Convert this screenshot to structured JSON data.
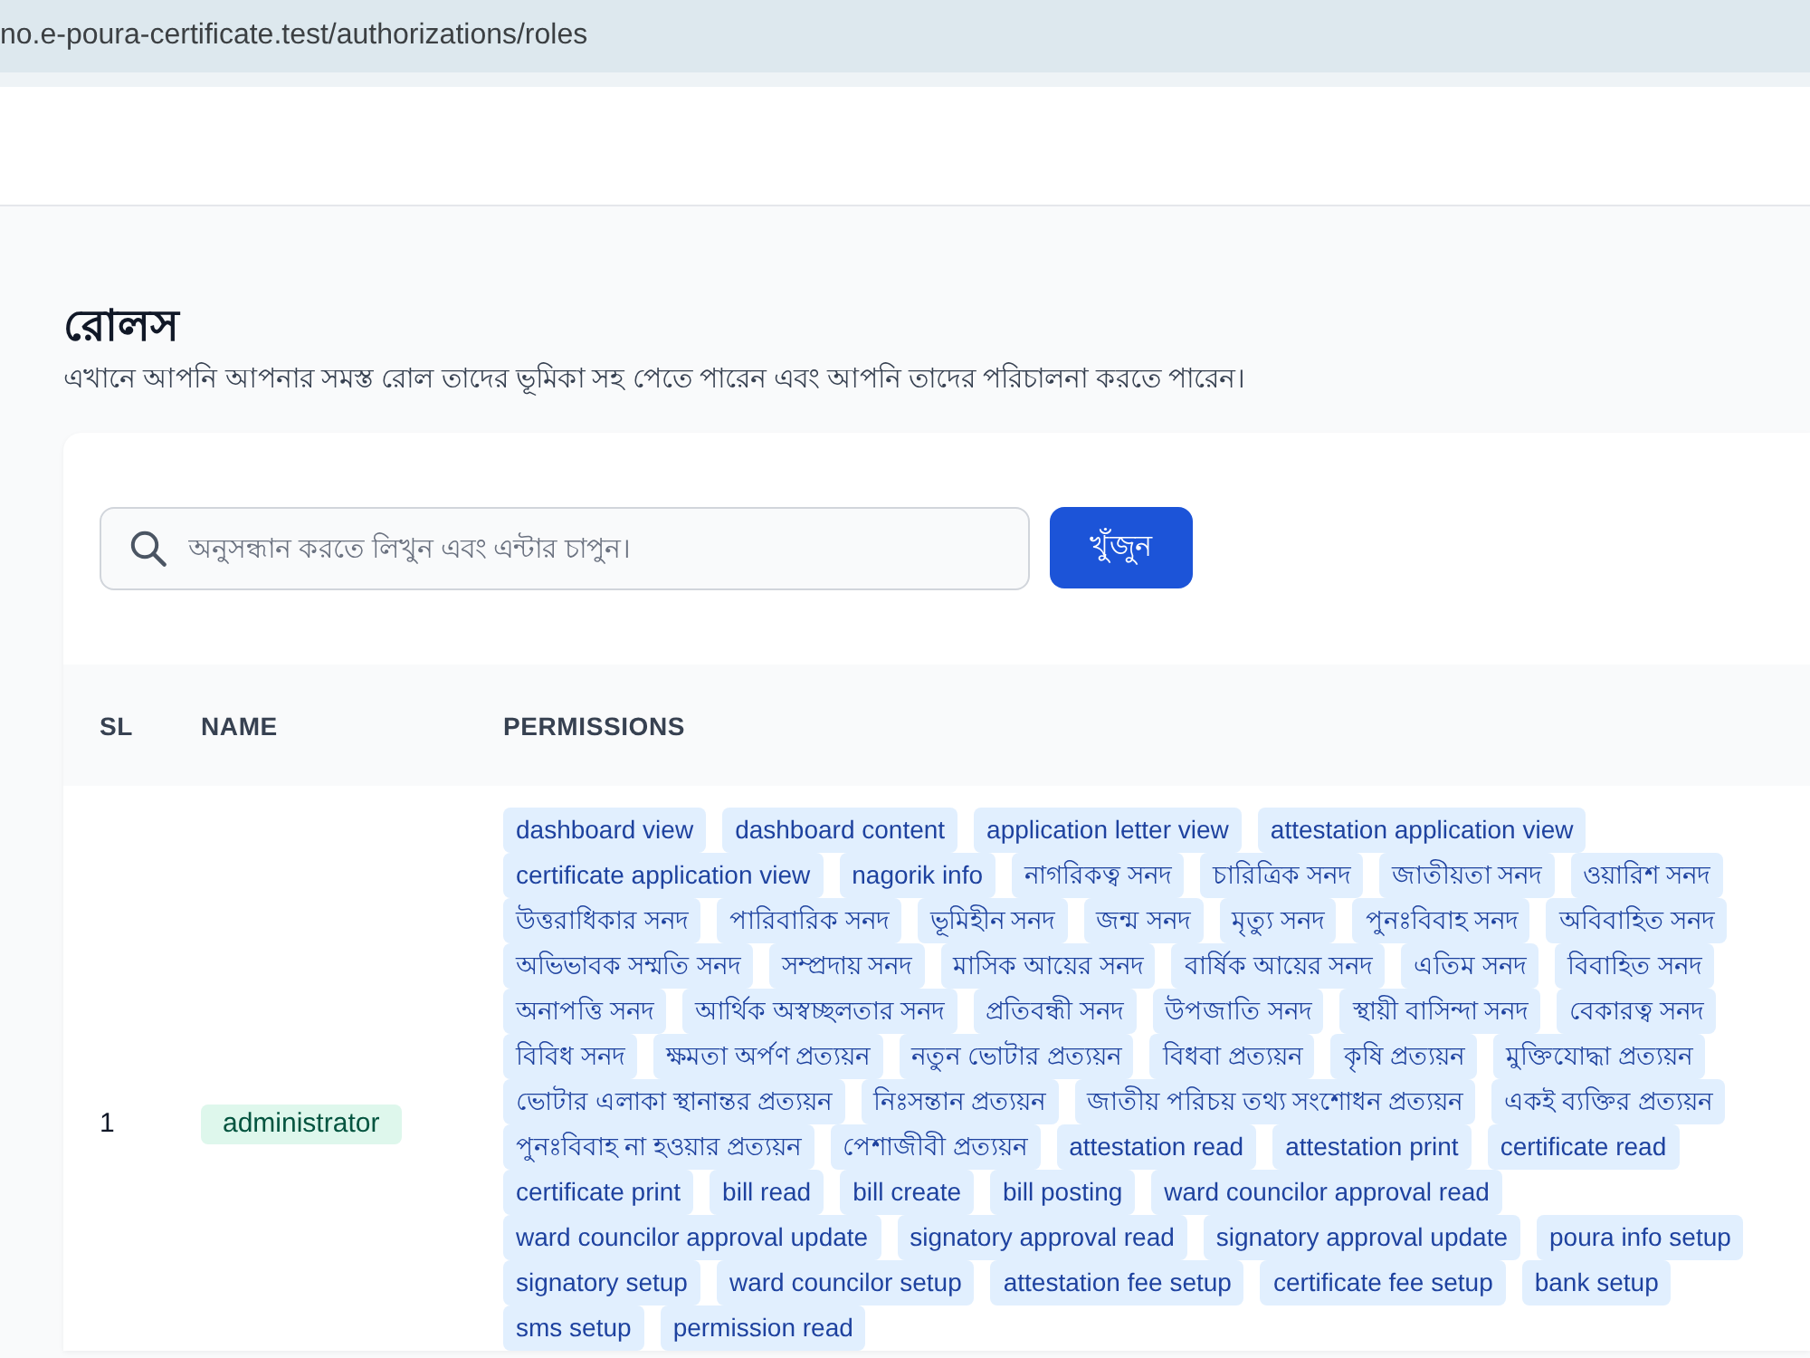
{
  "browser": {
    "url": "no.e-poura-certificate.test/authorizations/roles"
  },
  "page": {
    "title": "রোলস",
    "description": "এখানে আপনি আপনার সমস্ত রোল তাদের ভূমিকা সহ পেতে পারেন এবং আপনি তাদের পরিচালনা করতে পারেন।"
  },
  "search": {
    "placeholder": "অনুসন্ধান করতে লিখুন এবং এন্টার চাপুন।",
    "button": "খুঁজুন"
  },
  "table": {
    "columns": [
      "SL",
      "NAME",
      "PERMISSIONS"
    ],
    "rows": [
      {
        "sl": "1",
        "name": "administrator",
        "permissions": [
          "dashboard view",
          "dashboard content",
          "application letter view",
          "attestation application view",
          "certificate application view",
          "nagorik info",
          "নাগরিকত্ব সনদ",
          "চারিত্রিক সনদ",
          "জাতীয়তা সনদ",
          "ওয়ারিশ সনদ",
          "উত্তরাধিকার সনদ",
          "পারিবারিক সনদ",
          "ভূমিহীন সনদ",
          "জন্ম সনদ",
          "মৃত্যু সনদ",
          "পুনঃবিবাহ সনদ",
          "অবিবাহিত সনদ",
          "অভিভাবক সম্মতি সনদ",
          "সম্প্রদায় সনদ",
          "মাসিক আয়ের সনদ",
          "বার্ষিক আয়ের সনদ",
          "এতিম সনদ",
          "বিবাহিত সনদ",
          "অনাপত্তি সনদ",
          "আর্থিক অস্বচ্ছলতার সনদ",
          "প্রতিবন্ধী সনদ",
          "উপজাতি সনদ",
          "স্থায়ী বাসিন্দা সনদ",
          "বেকারত্ব সনদ",
          "বিবিধ সনদ",
          "ক্ষমতা অর্পণ প্রত্যয়ন",
          "নতুন ভোটার প্রত্যয়ন",
          "বিধবা প্রত্যয়ন",
          "কৃষি প্রত্যয়ন",
          "মুক্তিযোদ্ধা প্রত্যয়ন",
          "ভোটার এলাকা স্থানান্তর প্রত্যয়ন",
          "নিঃসন্তান প্রত্যয়ন",
          "জাতীয় পরিচয় তথ্য সংশোধন প্রত্যয়ন",
          "একই ব্যক্তির প্রত্যয়ন",
          "পুনঃবিবাহ না হওয়ার প্রত্যয়ন",
          "পেশাজীবী প্রত্যয়ন",
          "attestation read",
          "attestation print",
          "certificate read",
          "certificate print",
          "bill read",
          "bill create",
          "bill posting",
          "ward councilor approval read",
          "ward councilor approval update",
          "signatory approval read",
          "signatory approval update",
          "poura info setup",
          "signatory setup",
          "ward councilor setup",
          "attestation fee setup",
          "certificate fee setup",
          "bank setup",
          "sms setup",
          "permission read"
        ]
      }
    ]
  }
}
